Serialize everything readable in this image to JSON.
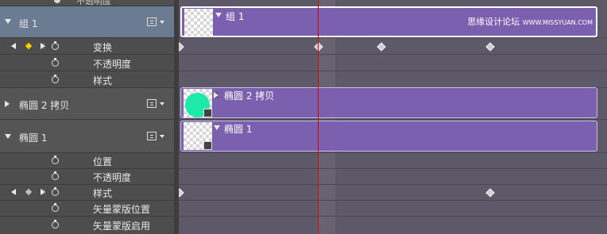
{
  "top_fragment": "不透明度",
  "layers": {
    "group1": {
      "name": "组 1",
      "properties": [
        "变换",
        "不透明度",
        "样式"
      ]
    },
    "ellipse2copy": {
      "name": "椭圆 2 拷贝"
    },
    "ellipse1": {
      "name": "椭圆 1",
      "properties": [
        "位置",
        "不透明度",
        "样式",
        "矢量蒙版位置",
        "矢量蒙版启用"
      ]
    }
  },
  "clips": {
    "group1": "组 1",
    "ellipse2copy": "椭圆 2 拷贝",
    "ellipse1": "椭圆 1"
  },
  "watermark": {
    "cn": "思缘设计论坛",
    "en": "WWW.MISSYUAN.COM"
  },
  "colors": {
    "clip": "#7b60b0",
    "group_header": "#6b7b91",
    "playhead": "#d40000",
    "ellipse_fill": "#1de9a8",
    "active_keyframe": "#f0d000"
  },
  "icons": [
    "triangle-expanded-icon",
    "triangle-collapsed-icon",
    "film-strip-icon",
    "stopwatch-icon",
    "keyframe-diamond-icon",
    "prev-keyframe-icon",
    "next-keyframe-icon",
    "vector-mask-icon"
  ]
}
